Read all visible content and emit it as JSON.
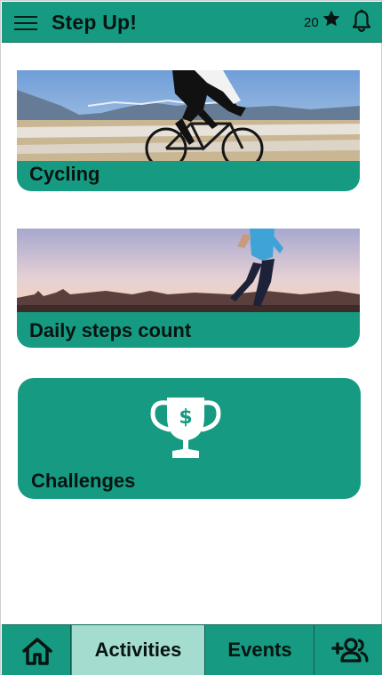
{
  "header": {
    "title": "Step Up!",
    "points": "20",
    "menu_icon": "hamburger-menu-icon",
    "star_icon": "star-icon",
    "bell_icon": "bell-icon"
  },
  "cards": [
    {
      "label": "Cycling",
      "image": "cyclist-photo"
    },
    {
      "label": "Daily steps count",
      "image": "runner-photo"
    },
    {
      "label": "Challenges",
      "icon": "trophy-dollar-icon"
    }
  ],
  "bottom_nav": {
    "home_icon": "home-icon",
    "activities": "Activities",
    "events": "Events",
    "friends_icon": "add-friend-icon",
    "active_tab": "Activities"
  },
  "colors": {
    "primary": "#169a82",
    "active_tab": "#a4dccf",
    "text": "#071411"
  }
}
